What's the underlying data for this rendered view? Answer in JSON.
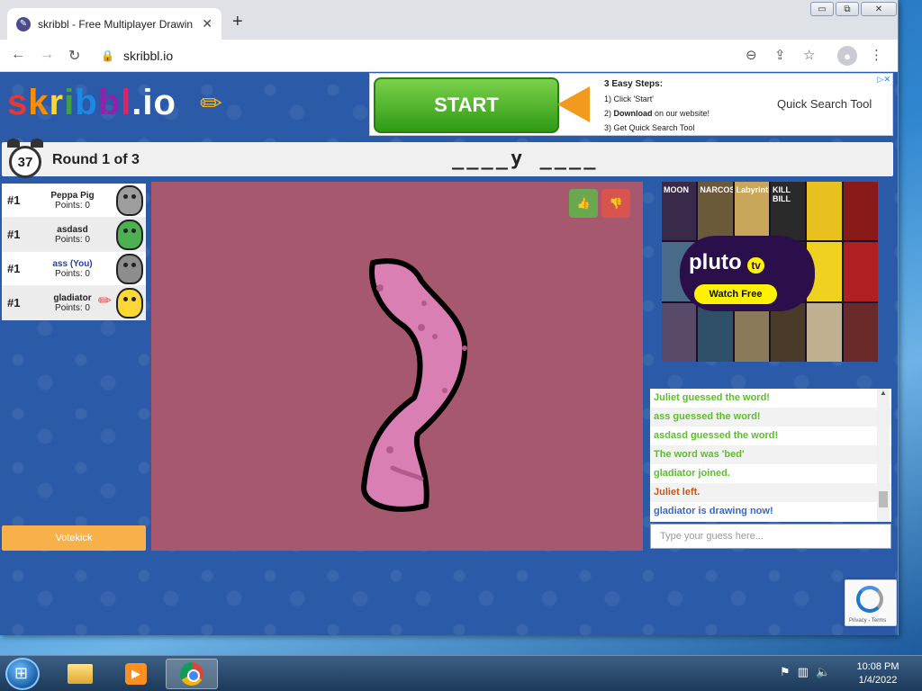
{
  "browser": {
    "tab_title": "skribbl - Free Multiplayer Drawin",
    "tab_close": "✕",
    "new_tab": "+",
    "url": "skribbl.io",
    "controls": {
      "minimize": "▭",
      "restore": "⧉",
      "close": "✕"
    }
  },
  "logo": {
    "parts": [
      "s",
      "k",
      "r",
      "i",
      "b",
      "b",
      "l",
      ".",
      "io"
    ]
  },
  "ad": {
    "start_label": "START",
    "steps_heading": "3 Easy Steps:",
    "step1": "1) Click 'Start'",
    "step2_bold": "Download",
    "step2_rest": " on our website!",
    "step3": "3) Get Quick Search Tool",
    "brand": "Quick Search Tool",
    "close": "▷✕"
  },
  "round": {
    "timer": "37",
    "label": "Round 1 of 3",
    "word_hint": "____y ____"
  },
  "players": [
    {
      "rank": "#1",
      "name": "Peppa Pig",
      "points": "Points: 0",
      "color": "#9e9e9e",
      "you": false
    },
    {
      "rank": "#1",
      "name": "asdasd",
      "points": "Points: 0",
      "color": "#4caf50",
      "you": false
    },
    {
      "rank": "#1",
      "name": "ass (You)",
      "points": "Points: 0",
      "color": "#8d8d8d",
      "you": true
    },
    {
      "rank": "#1",
      "name": "gladiator",
      "points": "Points: 0",
      "color": "#fdd835",
      "you": false,
      "drawing": true
    }
  ],
  "votekick_label": "Votekick",
  "canvas": {
    "background": "#a6586e",
    "stroke": "#000000",
    "fill": "#d97fb3",
    "dots": "#b25a8a"
  },
  "side_ad": {
    "brand_logo": "pluto",
    "brand_logo_suffix": "tv",
    "cta": "Watch Free",
    "tiles": [
      "MOON",
      "NARCOS",
      "Labyrinth",
      "KILL BILL",
      "",
      ""
    ]
  },
  "chat": [
    {
      "text": "Juliet guessed the word!",
      "style": "green"
    },
    {
      "text": "ass guessed the word!",
      "style": "green"
    },
    {
      "text": "asdasd guessed the word!",
      "style": "green"
    },
    {
      "text": "The word was 'bed'",
      "style": "green"
    },
    {
      "text": "gladiator joined.",
      "style": "green"
    },
    {
      "text": "Juliet left.",
      "style": "orange"
    },
    {
      "text": "gladiator is drawing now!",
      "style": "blue"
    }
  ],
  "guess_placeholder": "Type your guess here...",
  "recaptcha_text": "Privacy - Terms",
  "taskbar": {
    "time": "10:08 PM",
    "date": "1/4/2022"
  },
  "colors": {
    "page_bg": "#2b5aa8",
    "votekick": "#f7b04a",
    "chat_green": "#5bbf2c",
    "chat_orange": "#c3581c",
    "chat_blue": "#3a66c4"
  }
}
